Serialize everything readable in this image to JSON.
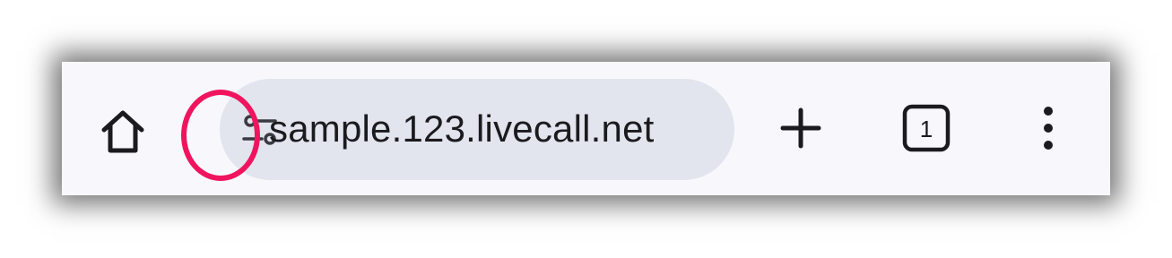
{
  "toolbar": {
    "url": "sample.123.livecall.net",
    "tab_count": "1"
  },
  "icons": {
    "home": "home-icon",
    "site_settings": "tune-icon",
    "new_tab": "plus-icon",
    "tab_switcher": "tab-switcher-icon",
    "menu": "more-vert-icon"
  },
  "colors": {
    "toolbar_bg": "#f8f8fc",
    "omnibox_bg": "#e2e5ee",
    "highlight": "#f0145e",
    "icon": "#1b1b1f"
  }
}
